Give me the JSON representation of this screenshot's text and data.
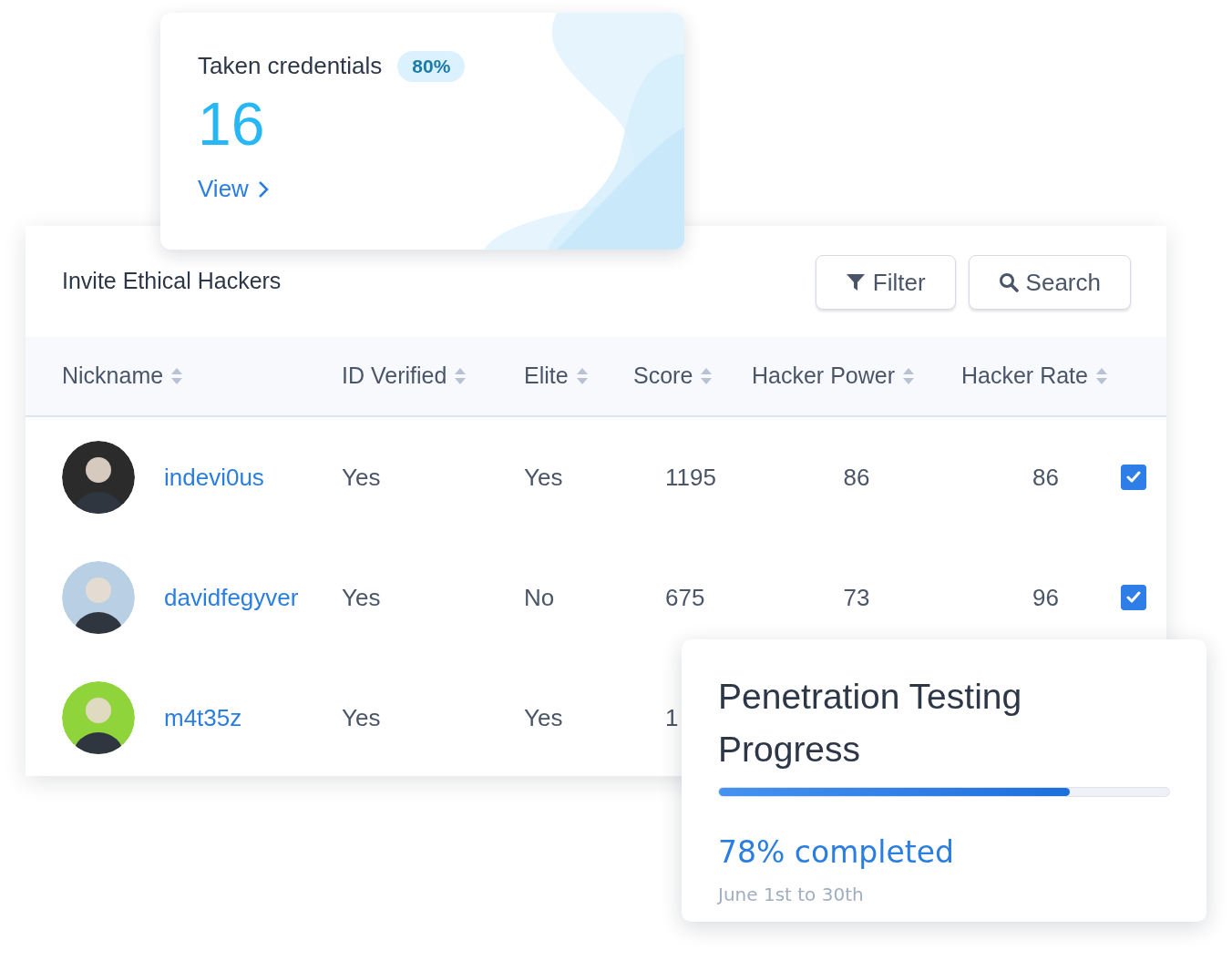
{
  "credentials_card": {
    "title": "Taken credentials",
    "badge": "80%",
    "value": "16",
    "link": "View"
  },
  "table_card": {
    "title": "Invite Ethical Hackers",
    "buttons": [
      {
        "kind": "filter",
        "label": "Filter"
      },
      {
        "kind": "search",
        "label": "Search"
      }
    ],
    "columns": [
      "Nickname",
      "ID Verified",
      "Elite",
      "Score",
      "Hacker Power",
      "Hacker Rate"
    ],
    "rows": [
      {
        "nickname": "indevi0us",
        "color": "#2b2b2b",
        "id_verified": "Yes",
        "elite": "Yes",
        "score": "1195",
        "hacker_power": "86",
        "hacker_rate": "86",
        "checked": true
      },
      {
        "nickname": "davidfegyver",
        "color": "#b9cfe3",
        "id_verified": "Yes",
        "elite": "No",
        "score": "675",
        "hacker_power": "73",
        "hacker_rate": "96",
        "checked": true
      },
      {
        "nickname": "m4t35z",
        "color": "#8fd43a",
        "id_verified": "Yes",
        "elite": "Yes",
        "score": "1"
      }
    ]
  },
  "progress_card": {
    "title": "Penetration Testing Progress",
    "level": 0.78,
    "reading": "78% completed",
    "period": "June 1st to 30th"
  }
}
